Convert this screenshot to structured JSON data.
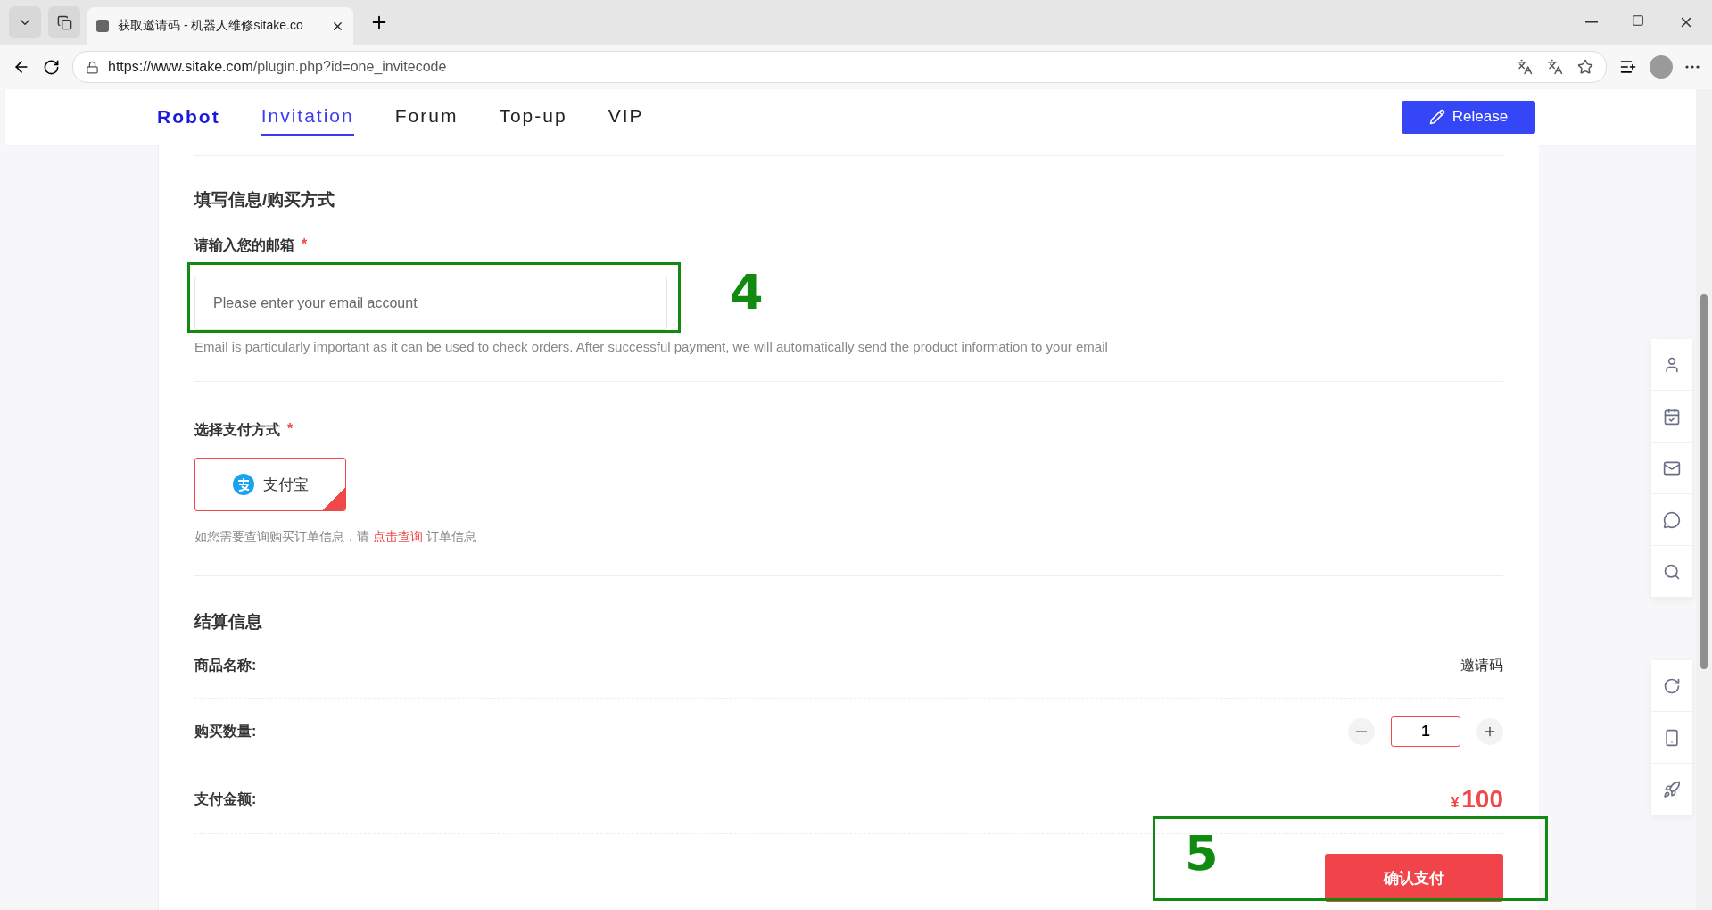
{
  "browser": {
    "tab_title": "获取邀请码 - 机器人维修sitake.co",
    "url_host": "https://www.sitake.com",
    "url_path": "/plugin.php?id=one_invitecode"
  },
  "nav": {
    "logo": "Robot",
    "items": [
      {
        "label": "Invitation",
        "selected": true
      },
      {
        "label": "Forum",
        "selected": false
      },
      {
        "label": "Top-up",
        "selected": false
      },
      {
        "label": "VIP",
        "selected": false
      }
    ],
    "release_button": "Release"
  },
  "form": {
    "section_title": "填写信息/购买方式",
    "email": {
      "label": "请输入您的邮箱",
      "required_mark": "*",
      "placeholder": "Please enter your email account",
      "help": "Email is particularly important as it can be used to check orders. After successful payment, we will automatically send the product information to your email"
    },
    "payment": {
      "label": "选择支付方式",
      "required_mark": "*",
      "options": [
        {
          "label": "支付宝",
          "selected": true
        }
      ],
      "note_before": "如您需要查询购买订单信息，请",
      "note_link": "点击查询",
      "note_after": "订单信息"
    }
  },
  "checkout": {
    "title": "结算信息",
    "product_label": "商品名称:",
    "product_value": "邀请码",
    "quantity_label": "购买数量:",
    "quantity_value": "1",
    "amount_label": "支付金额:",
    "currency": "¥",
    "amount": "100",
    "confirm_button": "确认支付"
  },
  "annotations": [
    {
      "label": "4"
    },
    {
      "label": "5"
    }
  ]
}
